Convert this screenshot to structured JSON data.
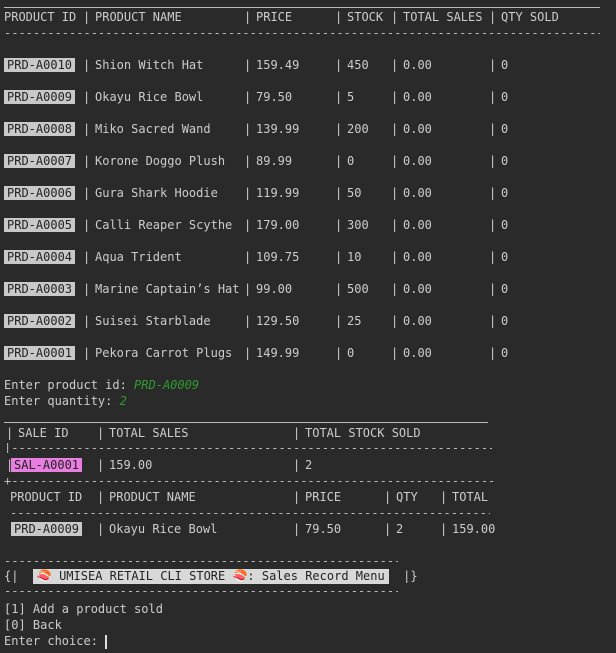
{
  "products_table": {
    "headers": [
      "PRODUCT ID",
      "PRODUCT NAME",
      "PRICE",
      "STOCK",
      "TOTAL SALES",
      "QTY SOLD"
    ],
    "rows": [
      {
        "id": "PRD-A0010",
        "name": "Shion Witch Hat",
        "price": "159.49",
        "stock": "450",
        "sales": "0.00",
        "qty": "0"
      },
      {
        "id": "PRD-A0009",
        "name": "Okayu Rice Bowl",
        "price": "79.50",
        "stock": "5",
        "sales": "0.00",
        "qty": "0"
      },
      {
        "id": "PRD-A0008",
        "name": "Miko Sacred Wand",
        "price": "139.99",
        "stock": "200",
        "sales": "0.00",
        "qty": "0"
      },
      {
        "id": "PRD-A0007",
        "name": "Korone Doggo Plush",
        "price": "89.99",
        "stock": "0",
        "sales": "0.00",
        "qty": "0"
      },
      {
        "id": "PRD-A0006",
        "name": "Gura Shark Hoodie",
        "price": "119.99",
        "stock": "50",
        "sales": "0.00",
        "qty": "0"
      },
      {
        "id": "PRD-A0005",
        "name": "Calli Reaper Scythe",
        "price": "179.00",
        "stock": "300",
        "sales": "0.00",
        "qty": "0"
      },
      {
        "id": "PRD-A0004",
        "name": "Aqua Trident",
        "price": "109.75",
        "stock": "10",
        "sales": "0.00",
        "qty": "0"
      },
      {
        "id": "PRD-A0003",
        "name": "Marine Captain’s Hat",
        "price": "99.00",
        "stock": "500",
        "sales": "0.00",
        "qty": "0"
      },
      {
        "id": "PRD-A0002",
        "name": "Suisei Starblade",
        "price": "129.50",
        "stock": "25",
        "sales": "0.00",
        "qty": "0"
      },
      {
        "id": "PRD-A0001",
        "name": "Pekora Carrot Plugs",
        "price": "149.99",
        "stock": "0",
        "sales": "0.00",
        "qty": "0"
      }
    ]
  },
  "input": {
    "product_prompt": "Enter product id: ",
    "product_value": "PRD-A0009",
    "qty_prompt": "Enter quantity: ",
    "qty_value": "2"
  },
  "sale_table": {
    "headers": [
      "SALE ID",
      "TOTAL SALES",
      "TOTAL STOCK SOLD"
    ],
    "sale_id": "SAL-A0001",
    "total_sales": "159.00",
    "total_stock_sold": "2",
    "item_headers": [
      "PRODUCT ID",
      "PRODUCT NAME",
      "PRICE",
      "QTY",
      "TOTAL"
    ],
    "item": {
      "id": "PRD-A0009",
      "name": "Okayu Rice Bowl",
      "price": "79.50",
      "qty": "2",
      "total": "159.00"
    }
  },
  "menu": {
    "title": "🍣 UMISEA RETAIL CLI STORE 🍣: Sales Record Menu",
    "options": [
      "[1] Add a product sold",
      "[0] Back"
    ],
    "choice_prompt": "Enter choice: "
  },
  "colors": {
    "background": "#2a2a2a",
    "text": "#cccccc",
    "badge": "#c8c8c8",
    "sale_badge": "#e87ee0",
    "input_green": "#2e9b2e"
  }
}
